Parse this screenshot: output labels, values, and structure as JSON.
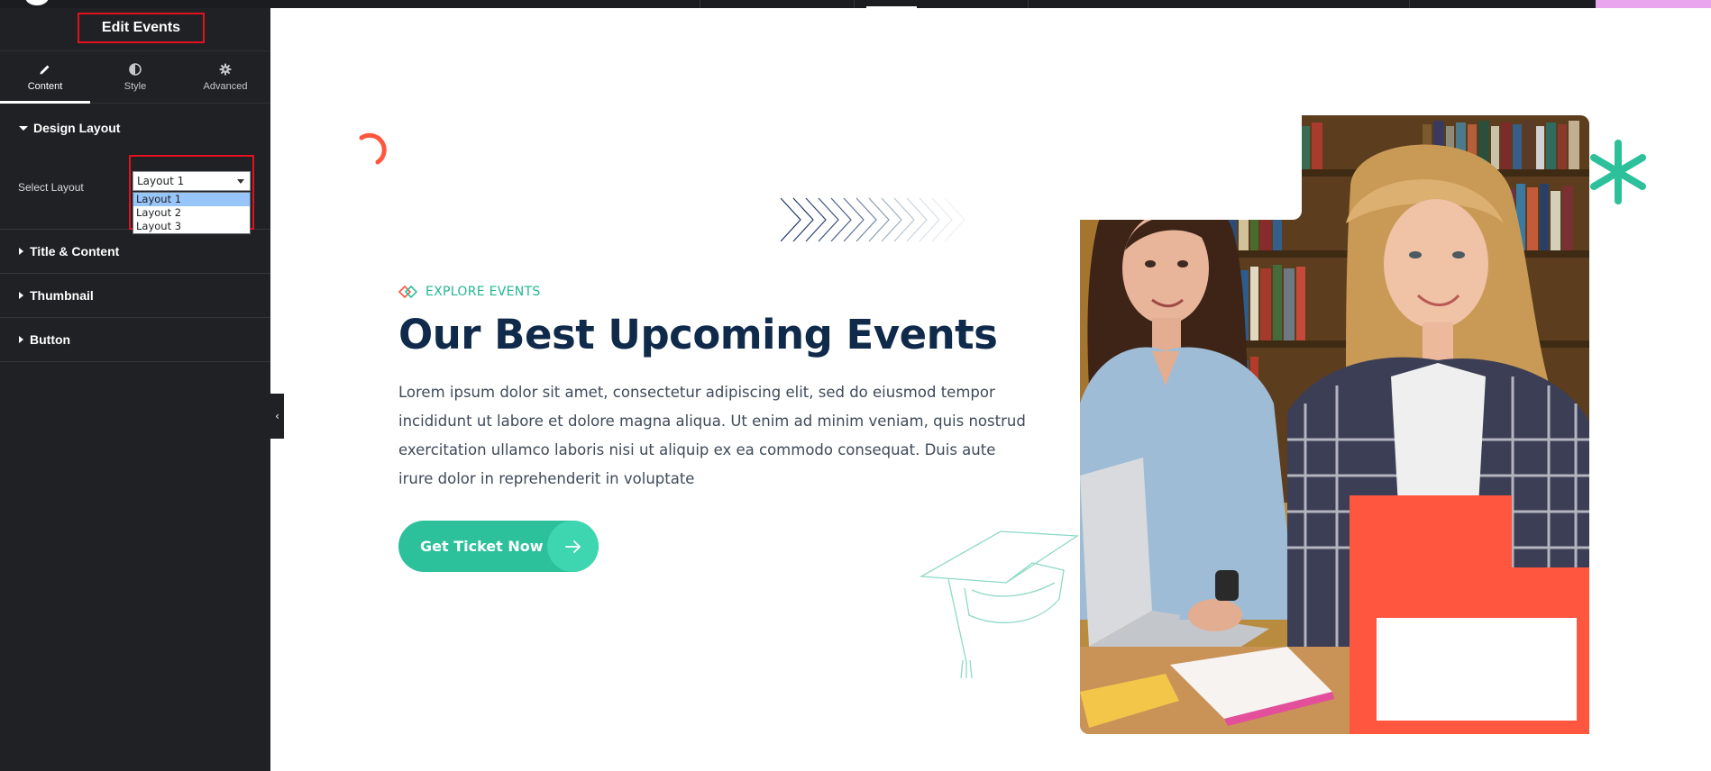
{
  "editor": {
    "title": "Edit Events",
    "tabs": [
      {
        "label": "Content",
        "icon": "pencil-icon",
        "active": true
      },
      {
        "label": "Style",
        "icon": "contrast-icon",
        "active": false
      },
      {
        "label": "Advanced",
        "icon": "gear-icon",
        "active": false
      }
    ],
    "sections": {
      "design_layout": "Design Layout",
      "title_content": "Title & Content",
      "thumbnail": "Thumbnail",
      "button": "Button"
    },
    "select_layout": {
      "label": "Select Layout",
      "value": "Layout 1",
      "options": [
        "Layout 1",
        "Layout 2",
        "Layout 3"
      ]
    },
    "collapse_icon": "chevron-left-icon"
  },
  "hero": {
    "kicker": "EXPLORE EVENTS",
    "heading": "Our Best Upcoming Events",
    "body": "Lorem ipsum dolor sit amet, consectetur adipiscing elit, sed do eiusmod tempor incididunt ut labore et dolore magna aliqua. Ut enim ad minim veniam, quis nostrud exercitation ullamco laboris nisi ut aliquip ex ea commodo consequat. Duis aute irure dolor in reprehenderit in voluptate",
    "cta_label": "Get Ticket Now"
  },
  "colors": {
    "panel_bg": "#1f2124",
    "highlight_border": "#e3111f",
    "accent_green": "#2cc09b",
    "heading_navy": "#0f2a4a",
    "decor_red": "#ff5640"
  }
}
